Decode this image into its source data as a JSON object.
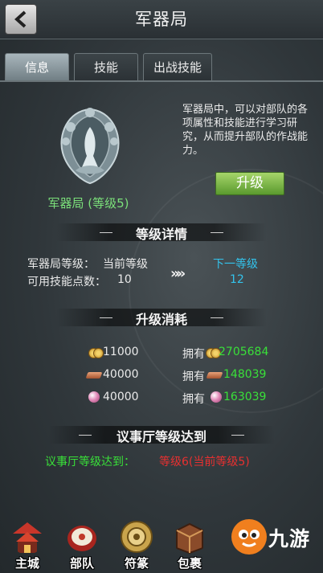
{
  "header": {
    "title": "军器局"
  },
  "tabs": [
    {
      "label": "信息",
      "active": true
    },
    {
      "label": "技能",
      "active": false
    },
    {
      "label": "出战技能",
      "active": false
    }
  ],
  "building": {
    "name": "军器局 (等级5)",
    "description": "军器局中，可以对部队的各项属性和技能进行学习研究，从而提升部队的作战能力。",
    "upgrade_label": "升级"
  },
  "level_details": {
    "section_title": "等级详情",
    "row1_label": "军器局等级：",
    "current_label": "当前等级",
    "next_label": "下一等级",
    "row2_label": "可用技能点数：",
    "current_points": "10",
    "next_points": "12",
    "arrow": "»"
  },
  "upgrade_cost": {
    "section_title": "升级消耗",
    "owned_label": "拥有",
    "items": [
      {
        "icon": "copper-coin-icon",
        "cost": "11000",
        "owned": "2705684"
      },
      {
        "icon": "wood-plank-icon",
        "cost": "40000",
        "owned": "148039"
      },
      {
        "icon": "spirit-orb-icon",
        "cost": "40000",
        "owned": "163039"
      }
    ]
  },
  "requirement": {
    "section_title": "议事厅等级达到",
    "label": "议事厅等级达到：",
    "value": "等级6(当前等级5)"
  },
  "bottom_nav": [
    {
      "label": "主城",
      "icon": "palace-icon"
    },
    {
      "label": "部队",
      "icon": "drum-icon"
    },
    {
      "label": "符篆",
      "icon": "talisman-icon"
    },
    {
      "label": "包裹",
      "icon": "bag-icon"
    }
  ],
  "watermark": {
    "text": "九游"
  },
  "colors": {
    "accent_green": "#39e039",
    "name_green": "#7be07a",
    "cyan": "#33c3ec",
    "red": "#e83030",
    "button_green": "#6fb03c"
  }
}
